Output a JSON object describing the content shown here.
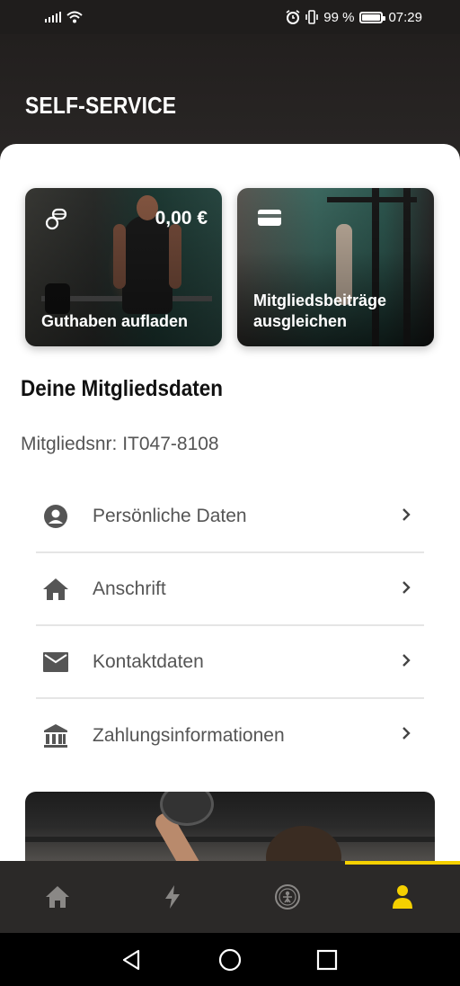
{
  "status_bar": {
    "battery_percent": "99 %",
    "time": "07:29"
  },
  "header": {
    "title": "SELF-SERVICE"
  },
  "cards": [
    {
      "label": "Guthaben aufladen",
      "amount": "0,00 €",
      "icon": "coins-icon"
    },
    {
      "label_line1": "Mitgliedsbeiträge",
      "label_line2": "ausgleichen",
      "icon": "credit-card-icon"
    }
  ],
  "member_section": {
    "title": "Deine Mitgliedsdaten",
    "member_number": "Mitgliedsnr: IT047-8108"
  },
  "menu": [
    {
      "label": "Persönliche Daten",
      "icon": "person-circle-icon"
    },
    {
      "label": "Anschrift",
      "icon": "home-icon"
    },
    {
      "label": "Kontaktdaten",
      "icon": "mail-icon"
    },
    {
      "label": "Zahlungsinformationen",
      "icon": "bank-icon"
    }
  ],
  "bottom_nav": {
    "items": [
      "home-icon",
      "lightning-icon",
      "gym-logo-icon",
      "profile-icon"
    ],
    "active_index": 3,
    "accent_color": "#f5d000",
    "inactive_color": "#8a8886"
  },
  "colors": {
    "header_bg": "#221f1e",
    "sheet_bg": "#ffffff",
    "text_dark": "#111111",
    "text_muted": "#555555"
  }
}
